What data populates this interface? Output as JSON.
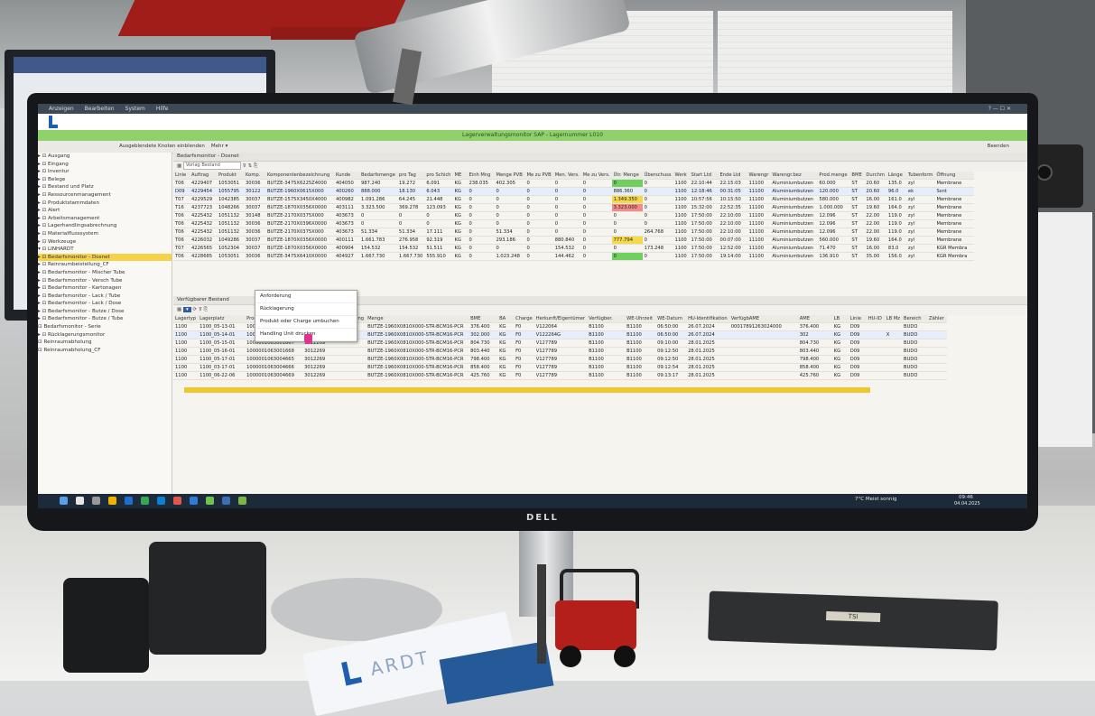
{
  "window": {
    "title": "Lagerverwaltungsmonitor SAP - Lagernummer L010",
    "menu": [
      "Anzeigen",
      "Bearbeiten",
      "System",
      "Hilfe"
    ],
    "toolbar_actions": [
      "Ausgeblendete Knoten einblenden",
      "Mehr"
    ],
    "toolbar_right": "Beenden"
  },
  "nav": {
    "items": [
      {
        "label": "▸ ⊡ Ausgang",
        "selected": false
      },
      {
        "label": "▸ ⊡ Eingang",
        "selected": false
      },
      {
        "label": "▸ ⊡ Inventur",
        "selected": false
      },
      {
        "label": "▸ ⊡ Belege",
        "selected": false
      },
      {
        "label": "▸ ⊡ Bestand und Platz",
        "selected": false
      },
      {
        "label": "▸ ⊡ Ressourcenmanagement",
        "selected": false
      },
      {
        "label": "▸ ⊡ Produktstammdaten",
        "selected": false
      },
      {
        "label": "▸ ⊡ Alert",
        "selected": false
      },
      {
        "label": "▸ ⊡ Arbeitsmanagement",
        "selected": false
      },
      {
        "label": "▸ ⊡ Lagerhandlingsabrechnung",
        "selected": false
      },
      {
        "label": "▸ ⊡ Materialflusssystem",
        "selected": false
      },
      {
        "label": "▸ ⊡ Werkzeuge",
        "selected": false
      },
      {
        "label": "▾ ⊡ LINHARDT",
        "selected": false
      },
      {
        "label": "   ▸ ⊡ Bedarfsmonitor - Dosnet",
        "selected": true
      },
      {
        "label": "   ▸ ⊡ Reinraumbeistellung_CF",
        "selected": false
      },
      {
        "label": "   ▸ ⊡ Bedarfsmonitor - Mischer Tube",
        "selected": false
      },
      {
        "label": "   ▸ ⊡ Bedarfsmonitor - Versch Tube",
        "selected": false
      },
      {
        "label": "   ▸ ⊡ Bedarfsmonitor - Kartonagen",
        "selected": false
      },
      {
        "label": "   ▸ ⊡ Bedarfsmonitor - Lack / Tube",
        "selected": false
      },
      {
        "label": "   ▸ ⊡ Bedarfsmonitor - Lack / Dose",
        "selected": false
      },
      {
        "label": "   ▸ ⊡ Bedarfsmonitor - Butze / Dose",
        "selected": false
      },
      {
        "label": "   ▸ ⊡ Bedarfsmonitor - Butze / Tube",
        "selected": false
      },
      {
        "label": "      ⊡ Bedarfsmonitor - Serie",
        "selected": false
      },
      {
        "label": "   ▸ ⊡ Rücklagerungsmonitor",
        "selected": false
      },
      {
        "label": "      ⊡ Reinraumabholung",
        "selected": false
      },
      {
        "label": "      ⊡ Reinraumabholung_CF",
        "selected": false
      }
    ]
  },
  "upper_panel": {
    "title": "Bedarfsmonitor - Dosnet",
    "filter_value": "Vorlag Bestand",
    "columns": [
      "Linie",
      "Auftrag",
      "Produkt",
      "Komp.",
      "Komponentenbezeichnung",
      "Kunde",
      "Bedarfsmenge",
      "pro Tag",
      "pro Schich",
      "ME",
      "Einh Mng",
      "Menge PVB",
      "Me zu PVB",
      "Men. Vers.",
      "Me zu Vers.",
      "Ütr. Menge",
      "Überschuss",
      "Werk",
      "Start Ltd",
      "Ende Ltd",
      "Warengr",
      "Warengr.bez",
      "Prod.menge",
      "BME",
      "Durchm",
      "Länge",
      "Tubenform",
      "Öffnung"
    ],
    "rows": [
      {
        "cells": [
          "T06",
          "4229407",
          "1053051",
          "30036",
          "BUTZE-3475X6225Z4000",
          "404050",
          "987.240",
          "19.272",
          "6.091",
          "KG",
          "238.035",
          "402.305",
          "0",
          "0",
          "0",
          "0",
          "0",
          "1100",
          "22:10:44",
          "22:15:03",
          "11100",
          "Aluminiumbutzen",
          "60.000",
          "ST",
          "20.60",
          "135.0",
          "zyl",
          "Membrane"
        ],
        "selected": false,
        "flag": "green"
      },
      {
        "cells": [
          "D09",
          "4229454",
          "1055795",
          "30122",
          "BUTZE-1960X0615X000",
          "400260",
          "888.000",
          "18.130",
          "6.043",
          "KG",
          "0",
          "0",
          "0",
          "0",
          "0",
          "886.360",
          "0",
          "1100",
          "12:18:46",
          "00:31:05",
          "11100",
          "Aluminiumbutzen",
          "120.000",
          "ST",
          "20.60",
          "96.0",
          "ek",
          "Ssnt"
        ],
        "selected": true,
        "flag": ""
      },
      {
        "cells": [
          "T07",
          "4229529",
          "1042385",
          "30037",
          "BUTZE-1575X3450X4000",
          "400982",
          "1.091.286",
          "64.245",
          "21.448",
          "KG",
          "0",
          "0",
          "0",
          "0",
          "0",
          "1.349.350",
          "0",
          "1100",
          "10:57:56",
          "10:15:50",
          "11100",
          "Aluminiumbutzen",
          "580.000",
          "ST",
          "16.00",
          "161.0",
          "zyl",
          "Membrane"
        ],
        "selected": false,
        "flag": "yellow"
      },
      {
        "cells": [
          "T16",
          "4237723",
          "1048266",
          "30037",
          "BUTZE-1870X0356X0000",
          "403111",
          "3.323.500",
          "369.278",
          "123.093",
          "KG",
          "0",
          "0",
          "0",
          "0",
          "0",
          "3.323.000",
          "0",
          "1100",
          "15:32:00",
          "22:52:35",
          "11100",
          "Aluminiumbutzen",
          "1.000.000",
          "ST",
          "19.60",
          "164.0",
          "zyl",
          "Membrane"
        ],
        "selected": false,
        "flag": "red"
      },
      {
        "cells": [
          "T06",
          "4225432",
          "1051132",
          "30148",
          "BUTZE-2170X0375X000",
          "403673",
          "0",
          "0",
          "0",
          "KG",
          "0",
          "0",
          "0",
          "0",
          "0",
          "0",
          "0",
          "1100",
          "17:50:00",
          "22:10:00",
          "11100",
          "Aluminiumbutzen",
          "12.096",
          "ST",
          "22.00",
          "119.0",
          "zyl",
          "Membrane"
        ],
        "selected": false,
        "flag": ""
      },
      {
        "cells": [
          "T06",
          "4225432",
          "1051132",
          "30036",
          "BUTZE-2170X0396X0000",
          "403673",
          "0",
          "0",
          "0",
          "KG",
          "0",
          "0",
          "0",
          "0",
          "0",
          "0",
          "0",
          "1100",
          "17:50:00",
          "22:10:00",
          "11100",
          "Aluminiumbutzen",
          "12.096",
          "ST",
          "22.00",
          "119.0",
          "zyl",
          "Membrane"
        ],
        "selected": false,
        "flag": ""
      },
      {
        "cells": [
          "T06",
          "4225432",
          "1051132",
          "30036",
          "BUTZE-2170X0375X000",
          "403673",
          "51.334",
          "51.334",
          "17.111",
          "KG",
          "0",
          "51.334",
          "0",
          "0",
          "0",
          "0",
          "264.768",
          "1100",
          "17:50:00",
          "22:10:00",
          "11100",
          "Aluminiumbutzen",
          "12.096",
          "ST",
          "22.00",
          "119.0",
          "zyl",
          "Membrane"
        ],
        "selected": false,
        "flag": ""
      },
      {
        "cells": [
          "T06",
          "4226032",
          "1049286",
          "30037",
          "BUTZE-1870X0356X0000",
          "400111",
          "1.661.783",
          "276.958",
          "92.319",
          "KG",
          "0",
          "293.186",
          "0",
          "880.840",
          "0",
          "777.794",
          "0",
          "1100",
          "17:50:00",
          "00:07:00",
          "11100",
          "Aluminiumbutzen",
          "560.000",
          "ST",
          "19.60",
          "164.0",
          "zyl",
          "Membrane"
        ],
        "selected": false,
        "flag": "yellow"
      },
      {
        "cells": [
          "T07",
          "4226565",
          "1052304",
          "30037",
          "BUTZE-1870X0356X0000",
          "400904",
          "154.532",
          "154.532",
          "51.511",
          "KG",
          "0",
          "0",
          "0",
          "154.532",
          "0",
          "0",
          "173.248",
          "1100",
          "17:50:00",
          "12:52:00",
          "11100",
          "Aluminiumbutzen",
          "71.470",
          "ST",
          "16.00",
          "83.0",
          "zyl",
          "KGR Membra"
        ],
        "selected": false,
        "flag": ""
      },
      {
        "cells": [
          "T06",
          "4228685",
          "1053051",
          "30036",
          "BUTZE-3475X6410X0000",
          "404927",
          "1.667.730",
          "1.667.730",
          "555.910",
          "KG",
          "0",
          "1.023.248",
          "0",
          "144.462",
          "0",
          "0",
          "0",
          "1100",
          "17:50:00",
          "19:14:00",
          "11100",
          "Aluminiumbutzen",
          "136.910",
          "ST",
          "35.00",
          "156.0",
          "zyl",
          "KGR Membra"
        ],
        "selected": false,
        "flag": "green"
      }
    ]
  },
  "lower_panel": {
    "title": "Verfügbarer Bestand",
    "columns": [
      "Lagertyp",
      "Lagerplatz",
      "Produkt",
      "Produktkurzbeschreibung",
      "Menge",
      "BME",
      "BA",
      "Charge",
      "Herkunft/Eigentümer",
      "Verfügber.",
      "WE-Uhrzeit",
      "WE-Datum",
      "HU-Identifikation",
      "VerfügbAME",
      "AME",
      "LB",
      "Linie",
      "HU-ID",
      "LB Mz",
      "Bereich",
      "Zähler"
    ],
    "rows": [
      {
        "cells": [
          "1100",
          "1100_05-13-01",
          "1000001063001123",
          "3012269",
          "BUTZE-1960X0810X000-STR-BCM16-PCR",
          "376.400",
          "KG",
          "F0",
          "V122064",
          "B1100",
          "B1100",
          "06:50:00",
          "26.07.2024",
          "00017891263024000",
          "376.400",
          "KG",
          "D09",
          "",
          "",
          "BUDO",
          ""
        ],
        "selected": false
      },
      {
        "cells": [
          "1100",
          "1100_05-14-01",
          "1000001063001729",
          "3012269",
          "BUTZE-1960X0810X000-STR-BCM16-PCR",
          "302.000",
          "KG",
          "F0",
          "V122264G",
          "B1100",
          "B1100",
          "06:50:00",
          "26.07.2024",
          "",
          "302",
          "KG",
          "D09",
          "",
          "X",
          "BUDO",
          ""
        ],
        "selected": true
      },
      {
        "cells": [
          "1100",
          "1100_05-15-01",
          "1000001063001667",
          "3012269",
          "BUTZE-1960X0810X000-STR-BCM16-PCR",
          "804.730",
          "KG",
          "F0",
          "V127789",
          "B1100",
          "B1100",
          "09:10:00",
          "28.01.2025",
          "",
          "804.730",
          "KG",
          "D09",
          "",
          "",
          "BUDO",
          ""
        ],
        "selected": false
      },
      {
        "cells": [
          "1100",
          "1100_05-16-01",
          "1000001063001668",
          "3012269",
          "BUTZE-1960X0810X000-STR-BCM16-PCR",
          "803.440",
          "KG",
          "F0",
          "V127789",
          "B1100",
          "B1100",
          "09:12:50",
          "28.01.2025",
          "",
          "803.440",
          "KG",
          "D09",
          "",
          "",
          "BUDO",
          ""
        ],
        "selected": false
      },
      {
        "cells": [
          "1100",
          "1100_05-17-01",
          "1000001063004665",
          "3012269",
          "BUTZE-1960X0810X000-STR-BCM16-PCR",
          "798.400",
          "KG",
          "F0",
          "V127789",
          "B1100",
          "B1100",
          "09:12:50",
          "28.01.2025",
          "",
          "798.400",
          "KG",
          "D09",
          "",
          "",
          "BUDO",
          ""
        ],
        "selected": false
      },
      {
        "cells": [
          "1100",
          "1100_03-17-01",
          "1000001063004666",
          "3012269",
          "BUTZE-1960X0810X000-STR-BCM16-PCR",
          "858.400",
          "KG",
          "F0",
          "V127789",
          "B1100",
          "B1100",
          "09:12:54",
          "28.01.2025",
          "",
          "858.400",
          "KG",
          "D09",
          "",
          "",
          "BUDO",
          ""
        ],
        "selected": false
      },
      {
        "cells": [
          "1100",
          "1100_06-22-06",
          "1000001063004669",
          "3012269",
          "BUTZE-1960X0810X000-STR-BCM16-PCR",
          "425.760",
          "KG",
          "F0",
          "V127789",
          "B1100",
          "B1100",
          "09:13:17",
          "28.01.2025",
          "",
          "425.760",
          "KG",
          "D09",
          "",
          "",
          "BUDO",
          ""
        ],
        "selected": false
      }
    ]
  },
  "context_menu": {
    "items": [
      "Anforderung",
      "Rücklagerung",
      "Produkt oder Charge umbuchen",
      "Handling Unit drucken"
    ]
  },
  "taskbar": {
    "weather": "7°C Meist sonnig",
    "time": "09:46",
    "date": "04.04.2025"
  },
  "desk": {
    "monitor_brand": "DELL",
    "card_text": "ARDT",
    "tray_label": "TSI"
  }
}
